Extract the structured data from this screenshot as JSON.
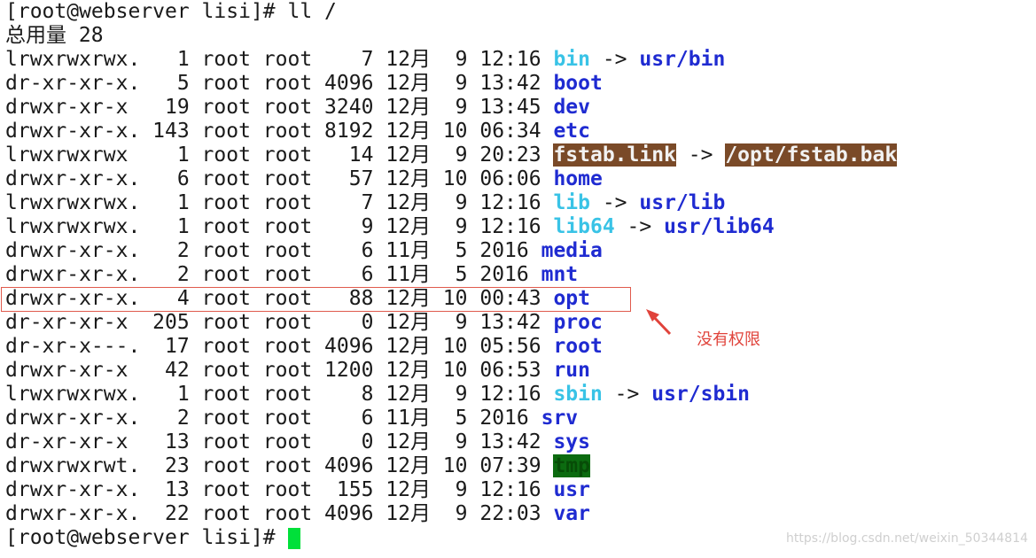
{
  "terminal": {
    "command_line": "[root@webserver lisi]# ll /",
    "total_line": "总用量 28",
    "prompt": "[root@webserver lisi]# ",
    "entries": [
      {
        "meta": "lrwxrwxrwx.   1 root root    7 12月  9 12:16 ",
        "name": "bin",
        "target": "usr/bin",
        "style": "cyan"
      },
      {
        "meta": "dr-xr-xr-x.   5 root root 4096 12月  9 13:42 ",
        "name": "boot",
        "style": "blue"
      },
      {
        "meta": "drwxr-xr-x   19 root root 3240 12月  9 13:45 ",
        "name": "dev",
        "style": "blue"
      },
      {
        "meta": "drwxr-xr-x. 143 root root 8192 12月 10 06:34 ",
        "name": "etc",
        "style": "blue"
      },
      {
        "meta": "lrwxrwxrwx    1 root root   14 12月  9 20:23 ",
        "name": "fstab.link",
        "target": "/opt/fstab.bak",
        "style": "link-bg",
        "target_style": "link-bg"
      },
      {
        "meta": "drwxr-xr-x.   6 root root   57 12月 10 06:06 ",
        "name": "home",
        "style": "blue"
      },
      {
        "meta": "lrwxrwxrwx.   1 root root    7 12月  9 12:16 ",
        "name": "lib",
        "target": "usr/lib",
        "style": "cyan"
      },
      {
        "meta": "lrwxrwxrwx.   1 root root    9 12月  9 12:16 ",
        "name": "lib64",
        "target": "usr/lib64",
        "style": "cyan"
      },
      {
        "meta": "drwxr-xr-x.   2 root root    6 11月  5 2016 ",
        "name": "media",
        "style": "blue"
      },
      {
        "meta": "drwxr-xr-x.   2 root root    6 11月  5 2016 ",
        "name": "mnt",
        "style": "blue"
      },
      {
        "meta": "drwxr-xr-x.   4 root root   88 12月 10 00:43 ",
        "name": "opt",
        "style": "blue"
      },
      {
        "meta": "dr-xr-xr-x  205 root root    0 12月  9 13:42 ",
        "name": "proc",
        "style": "blue"
      },
      {
        "meta": "dr-xr-x---.  17 root root 4096 12月 10 05:56 ",
        "name": "root",
        "style": "blue"
      },
      {
        "meta": "drwxr-xr-x   42 root root 1200 12月 10 06:53 ",
        "name": "run",
        "style": "blue"
      },
      {
        "meta": "lrwxrwxrwx.   1 root root    8 12月  9 12:16 ",
        "name": "sbin",
        "target": "usr/sbin",
        "style": "cyan"
      },
      {
        "meta": "drwxr-xr-x.   2 root root    6 11月  5 2016 ",
        "name": "srv",
        "style": "blue"
      },
      {
        "meta": "dr-xr-xr-x   13 root root    0 12月  9 13:42 ",
        "name": "sys",
        "style": "blue"
      },
      {
        "meta": "drwxrwxrwt.  23 root root 4096 12月 10 07:39 ",
        "name": "tmp",
        "style": "dir-bg"
      },
      {
        "meta": "drwxr-xr-x.  13 root root  155 12月  9 12:16 ",
        "name": "usr",
        "style": "blue"
      },
      {
        "meta": "drwxr-xr-x.  22 root root 4096 12月  9 22:03 ",
        "name": "var",
        "style": "blue"
      }
    ],
    "link_arrow": " -> "
  },
  "annotation": {
    "text": "没有权限"
  },
  "watermark": "https://blog.csdn.net/weixin_50344814",
  "colors": {
    "dir": "#1f2bd1",
    "symlink": "#39c3e6",
    "highlight_box": "#e05a4d",
    "annotation": "#e0433b",
    "cursor": "#00e03a"
  }
}
